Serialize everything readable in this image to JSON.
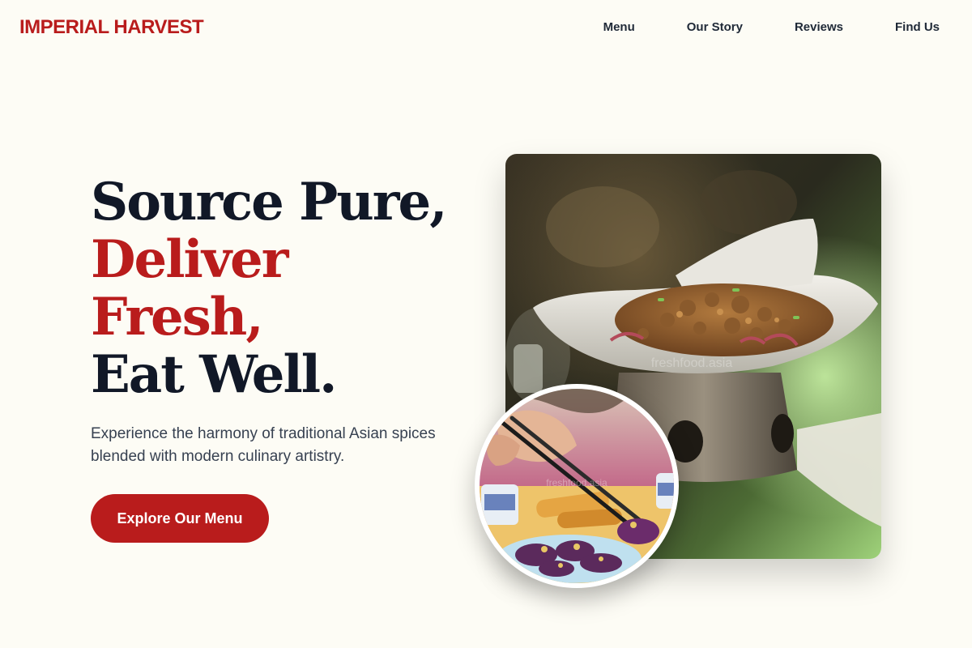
{
  "brand": {
    "name": "IMPERIAL HARVEST",
    "color": "#b91c1c"
  },
  "nav": {
    "items": [
      {
        "label": "Menu"
      },
      {
        "label": "Our Story"
      },
      {
        "label": "Reviews"
      },
      {
        "label": "Find Us"
      }
    ]
  },
  "hero": {
    "title_lines": [
      {
        "text": "Source Pure,",
        "accent": false
      },
      {
        "text": "Deliver",
        "accent": true
      },
      {
        "text": "Fresh,",
        "accent": true
      },
      {
        "text": "Eat Well.",
        "accent": false
      }
    ],
    "subtitle": "Experience the harmony of traditional Asian spices blended with modern culinary artistry.",
    "cta_label": "Explore Our Menu"
  },
  "images": {
    "main_photo": "stir-fried-meat-dish-on-warmer-photo",
    "main_watermark": "freshfood.asia",
    "circle_photo": "chopsticks-eggplant-dish-photo",
    "circle_watermark": "freshfood.asia"
  },
  "colors": {
    "background": "#fdfcf5",
    "accent": "#b91c1c",
    "text_dark": "#111827",
    "text_body": "#374151"
  }
}
